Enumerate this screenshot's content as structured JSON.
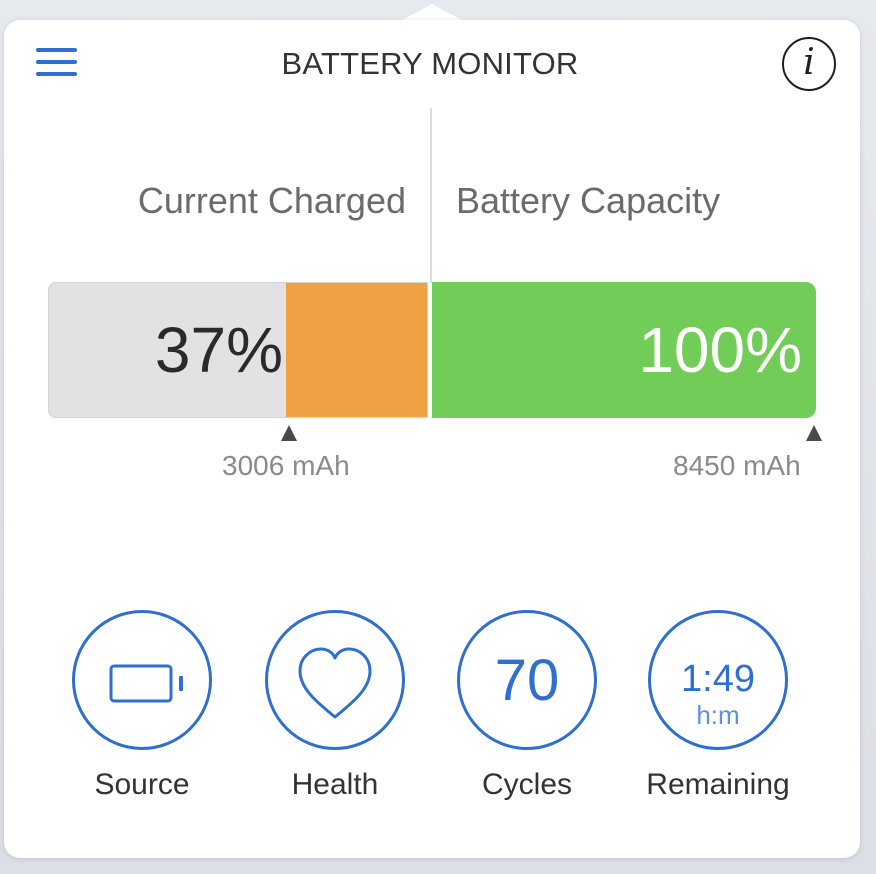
{
  "header": {
    "title": "BATTERY MONITOR",
    "menu_icon": "hamburger-menu-icon",
    "info_icon": "info-icon",
    "info_glyph": "i"
  },
  "current_charged": {
    "label": "Current Charged",
    "percent_text": "37%",
    "percent": 37,
    "mah_text": "3006 mAh"
  },
  "battery_capacity": {
    "label": "Battery Capacity",
    "percent_text": "100%",
    "percent": 100,
    "mah_text": "8450 mAh"
  },
  "stats": {
    "source": {
      "label": "Source",
      "icon": "battery-icon"
    },
    "health": {
      "label": "Health",
      "icon": "heart-icon"
    },
    "cycles": {
      "label": "Cycles",
      "value": "70"
    },
    "remaining": {
      "label": "Remaining",
      "value": "1:49",
      "unit": "h:m"
    }
  },
  "colors": {
    "accent": "#2f6fcf",
    "charge_orange": "#efa243",
    "capacity_green": "#72cc58",
    "gauge_empty": "#e2e2e5"
  }
}
